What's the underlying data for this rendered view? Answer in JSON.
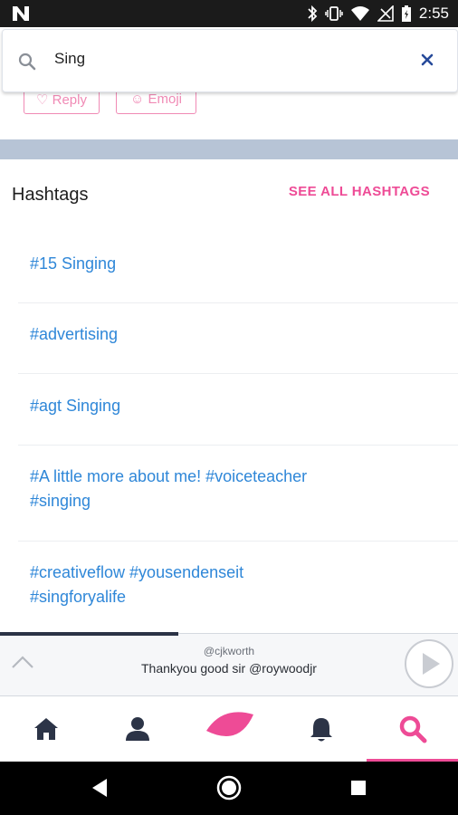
{
  "status_bar": {
    "time": "2:55",
    "icons": [
      "notification-n-icon",
      "bluetooth-icon",
      "vibrate-icon",
      "wifi-icon",
      "no-signal-icon",
      "battery-icon"
    ]
  },
  "search": {
    "query": "Sing",
    "icon": "search-icon",
    "clear_icon": "close-icon"
  },
  "partial_buttons": {
    "reply_label": "♡ Reply",
    "emoji_label": "☺ Emoji"
  },
  "hashtags": {
    "title": "Hashtags",
    "see_all_label": "SEE ALL HASHTAGS",
    "items": [
      {
        "label": "#15 Singing"
      },
      {
        "label": "#advertising"
      },
      {
        "label": "#agt Singing"
      },
      {
        "label": "#A little more about me! #voiceteacher #singing"
      },
      {
        "label": "#creativeflow #yousendenseit #singforyalife"
      }
    ]
  },
  "now_playing": {
    "username": "@cjkworth",
    "text": "Thankyou good sir @roywoodjr",
    "progress": 0.39
  },
  "bottom_nav": {
    "items": [
      "home-icon",
      "profile-icon",
      "create-icon",
      "notifications-icon",
      "search-icon"
    ],
    "active": "search"
  },
  "colors": {
    "accent": "#ee4b96",
    "link": "#2f87d8",
    "band": "#b7c4d6",
    "dark": "#2b3346"
  }
}
